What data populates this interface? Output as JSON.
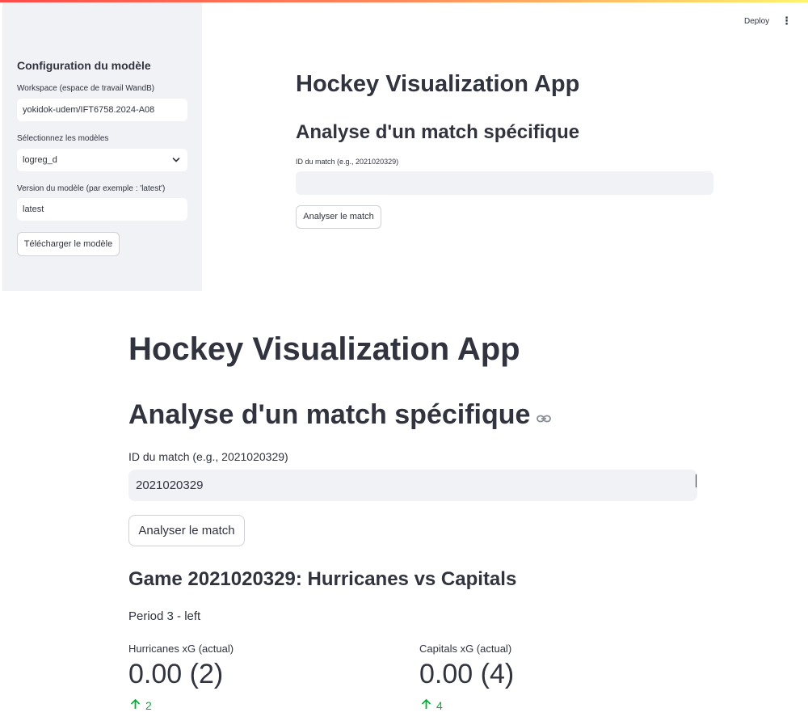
{
  "theme": {
    "accent_gradient": [
      "#ff4b4b",
      "#fff36e"
    ],
    "text": "#31333f",
    "input_bg": "#f0f2f6",
    "delta_positive": "#09ab3b"
  },
  "sidebar": {
    "title": "Configuration du modèle",
    "workspace": {
      "label": "Workspace (espace de travail WandB)",
      "value": "yokidok-udem/IFT6758.2024-A08"
    },
    "models": {
      "label": "Sélectionnez les modèles",
      "selected": "logreg_d",
      "icon": "chevron-down-icon"
    },
    "version": {
      "label": "Version du modèle (par exemple : 'latest')",
      "value": "latest"
    },
    "download_button": "Télécharger le modèle"
  },
  "header": {
    "deploy_label": "Deploy",
    "menu_icon": "kebab-menu-icon"
  },
  "main_top": {
    "title": "Hockey Visualization App",
    "subtitle": "Analyse d'un match spécifique",
    "match_id": {
      "label": "ID du match (e.g., 2021020329)",
      "value": ""
    },
    "analyze_button": "Analyser le match"
  },
  "main_zoom": {
    "title": "Hockey Visualization App",
    "subtitle": "Analyse d'un match spécifique",
    "link_icon": "link-icon",
    "match_id": {
      "label": "ID du match (e.g., 2021020329)",
      "value": "2021020329"
    },
    "analyze_button": "Analyser le match",
    "game_header": "Game 2021020329: Hurricanes vs Capitals",
    "period": "Period 3 - left",
    "metrics": [
      {
        "label": "Hurricanes xG (actual)",
        "value": "0.00 (2)",
        "delta": "2",
        "delta_icon": "arrow-up-icon"
      },
      {
        "label": "Capitals xG (actual)",
        "value": "0.00 (4)",
        "delta": "4",
        "delta_icon": "arrow-up-icon"
      }
    ]
  }
}
